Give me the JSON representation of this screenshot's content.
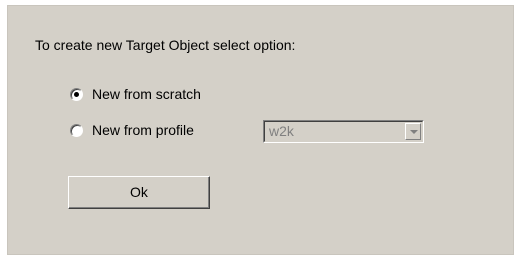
{
  "dialog": {
    "prompt": "To create new Target Object select option:",
    "options": [
      {
        "label": "New from scratch",
        "selected": true
      },
      {
        "label": "New from profile",
        "selected": false
      }
    ],
    "profile_select": {
      "value": "w2k",
      "enabled": false
    },
    "ok_label": "Ok"
  },
  "colors": {
    "panel_bg": "#d4d0c8",
    "disabled_text": "#808080"
  }
}
